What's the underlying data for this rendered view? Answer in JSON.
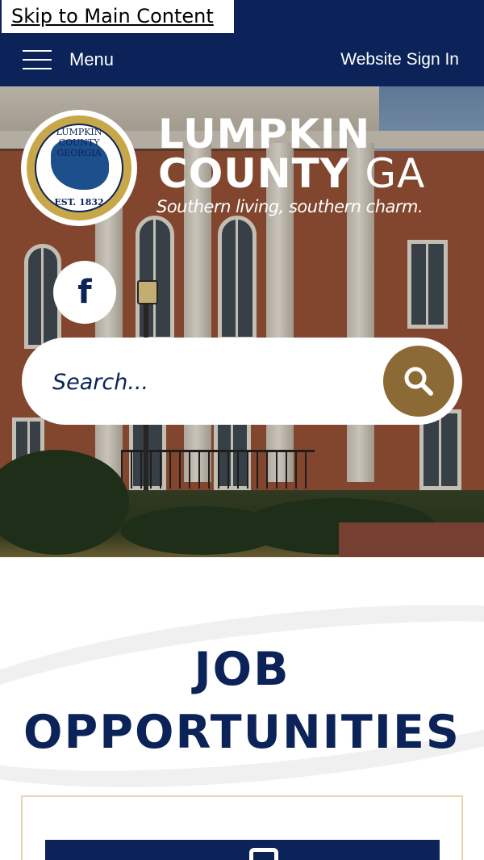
{
  "skip_link": {
    "label": "Skip to Main Content"
  },
  "nav": {
    "menu_label": "Menu",
    "sign_in_label": "Website Sign In"
  },
  "logo": {
    "line1": "LUMPKIN",
    "line2_bold": "COUNTY",
    "line2_light": "GA",
    "tagline": "Southern living, southern charm.",
    "seal_top_text": "LUMPKIN COUNTY GEORGIA",
    "seal_bottom_text": "EST. 1832"
  },
  "social": {
    "facebook_glyph": "f"
  },
  "search": {
    "placeholder": "Search..."
  },
  "main": {
    "title_line1": "JOB",
    "title_line2": "OPPORTUNITIES"
  },
  "colors": {
    "navy": "#0b2358",
    "gold": "#8c6a35",
    "card_border": "#e6d6b0"
  },
  "icons": [
    "hamburger-icon",
    "facebook-icon",
    "search-icon",
    "briefcase-icon"
  ]
}
